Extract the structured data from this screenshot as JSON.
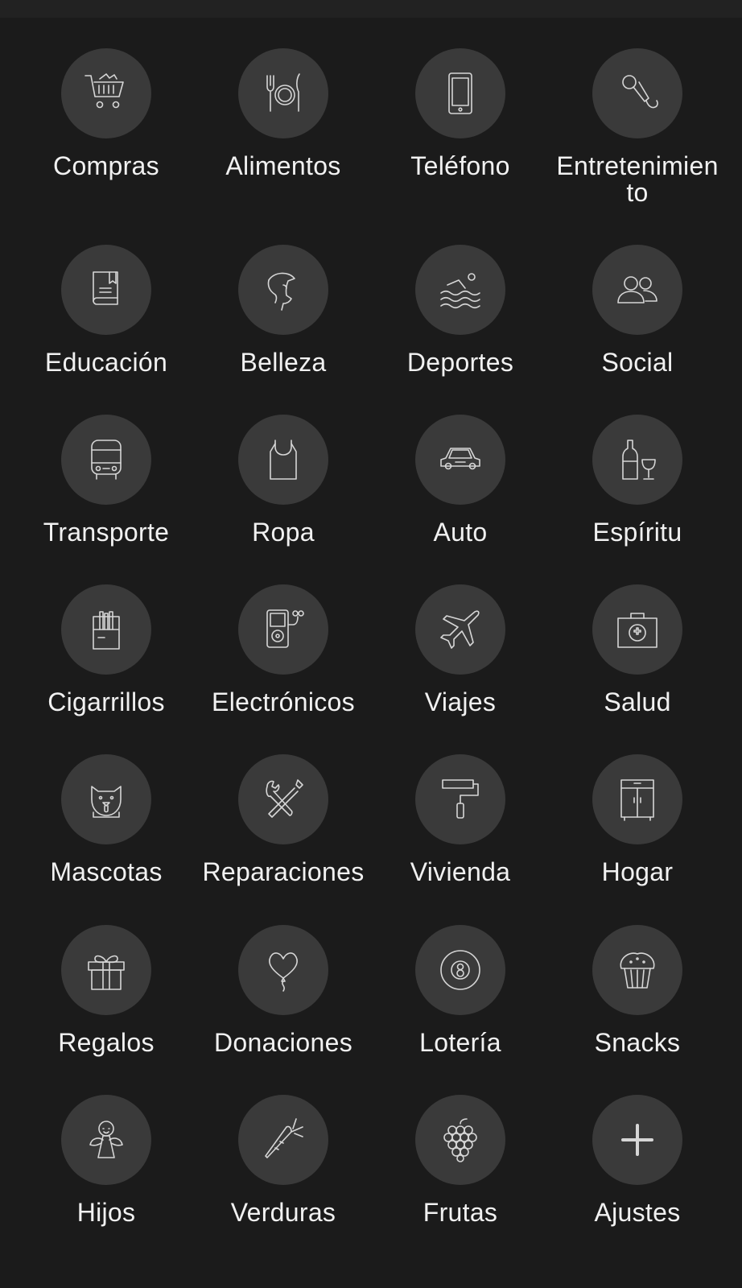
{
  "colors": {
    "background": "#1b1b1b",
    "circle": "#3a3a3a",
    "icon_stroke": "#d6d6d6",
    "label": "#f1f1f1"
  },
  "categories": [
    {
      "label": "Compras",
      "icon": "shopping-cart-icon"
    },
    {
      "label": "Alimentos",
      "icon": "cutlery-plate-icon"
    },
    {
      "label": "Teléfono",
      "icon": "phone-icon"
    },
    {
      "label": "Entretenimiento",
      "icon": "microphone-icon"
    },
    {
      "label": "Educación",
      "icon": "book-icon"
    },
    {
      "label": "Belleza",
      "icon": "woman-head-icon"
    },
    {
      "label": "Deportes",
      "icon": "swimmer-icon"
    },
    {
      "label": "Social",
      "icon": "people-icon"
    },
    {
      "label": "Transporte",
      "icon": "bus-icon"
    },
    {
      "label": "Ropa",
      "icon": "tank-top-icon"
    },
    {
      "label": "Auto",
      "icon": "car-icon"
    },
    {
      "label": "Espíritu",
      "icon": "wine-bottle-glass-icon"
    },
    {
      "label": "Cigarrillos",
      "icon": "cigarette-pack-icon"
    },
    {
      "label": "Electrónicos",
      "icon": "music-player-icon"
    },
    {
      "label": "Viajes",
      "icon": "airplane-icon"
    },
    {
      "label": "Salud",
      "icon": "first-aid-kit-icon"
    },
    {
      "label": "Mascotas",
      "icon": "pet-face-icon"
    },
    {
      "label": "Reparaciones",
      "icon": "tools-icon"
    },
    {
      "label": "Vivienda",
      "icon": "paint-roller-icon"
    },
    {
      "label": "Hogar",
      "icon": "cabinet-icon"
    },
    {
      "label": "Regalos",
      "icon": "gift-icon"
    },
    {
      "label": "Donaciones",
      "icon": "heart-balloon-icon"
    },
    {
      "label": "Lotería",
      "icon": "eight-ball-icon"
    },
    {
      "label": "Snacks",
      "icon": "cupcake-icon"
    },
    {
      "label": "Hijos",
      "icon": "child-icon"
    },
    {
      "label": "Verduras",
      "icon": "carrot-icon"
    },
    {
      "label": "Frutas",
      "icon": "grapes-icon"
    },
    {
      "label": "Ajustes",
      "icon": "plus-icon"
    }
  ]
}
